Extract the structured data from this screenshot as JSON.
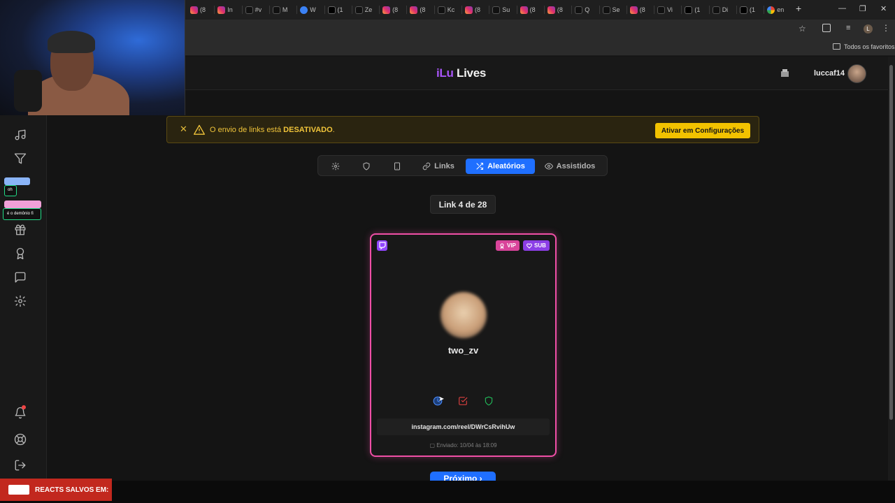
{
  "browser": {
    "tabs": [
      {
        "icon": "instagram-icon",
        "label": "(8"
      },
      {
        "icon": "instagram-icon",
        "label": "In"
      },
      {
        "icon": "tiktok-icon",
        "label": "#v"
      },
      {
        "icon": "tiktok-icon",
        "label": "M"
      },
      {
        "icon": "web-icon",
        "label": "W"
      },
      {
        "icon": "x-icon",
        "label": "(1"
      },
      {
        "icon": "tiktok-icon",
        "label": "Ze"
      },
      {
        "icon": "instagram-icon",
        "label": "(8"
      },
      {
        "icon": "instagram-icon",
        "label": "(8"
      },
      {
        "icon": "tiktok-icon",
        "label": "Kc"
      },
      {
        "icon": "instagram-icon",
        "label": "(8"
      },
      {
        "icon": "tiktok-icon",
        "label": "Su"
      },
      {
        "icon": "instagram-icon",
        "label": "(8"
      },
      {
        "icon": "instagram-icon",
        "label": "(8"
      },
      {
        "icon": "tiktok-icon",
        "label": "Q"
      },
      {
        "icon": "tiktok-icon",
        "label": "Se"
      },
      {
        "icon": "instagram-icon",
        "label": "(8"
      },
      {
        "icon": "tiktok-icon",
        "label": "Vi"
      },
      {
        "icon": "x-icon",
        "label": "(1"
      },
      {
        "icon": "tiktok-icon",
        "label": "Di"
      },
      {
        "icon": "x-icon",
        "label": "(1"
      },
      {
        "icon": "google-icon",
        "label": "en"
      }
    ],
    "new_tab": "+",
    "bookmarks_all": "Todos os favoritos",
    "profile_initial": "L"
  },
  "site": {
    "logo_a": "iLu",
    "logo_b": "Lives",
    "user": "luccaf14"
  },
  "banner": {
    "text_prefix": "O envio de links está ",
    "text_state": "DESATIVADO",
    "text_suffix": ".",
    "button": "Ativar em Configurações",
    "accent": "#f2c200"
  },
  "tabs": {
    "links": "Links",
    "random": "Aleatórios",
    "watched": "Assistidos",
    "active": "Aleatórios"
  },
  "counter": "Link 4 de 28",
  "card": {
    "badges": [
      "VIP",
      "SUB"
    ],
    "username": "two_zv",
    "url": "instagram.com/reel/DWrCsRvihUw",
    "sent": "Enviado: 10/04 às 18:09",
    "border_color": "#ef4fa6"
  },
  "next_button": "Próximo ›",
  "chat_overlay": {
    "line1": "oh",
    "line2": "é o demônio fi"
  },
  "footer_overlay": "REACTS SALVOS EM:"
}
